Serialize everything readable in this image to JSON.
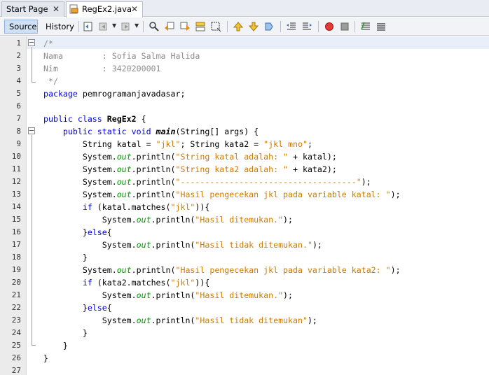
{
  "tabs": [
    {
      "label": "Start Page",
      "close": "✕"
    },
    {
      "label": "RegEx2.java",
      "close": "✕"
    }
  ],
  "toolbar": {
    "source_label": "Source",
    "history_label": "History"
  },
  "editor": {
    "line_numbers": [
      "1",
      "2",
      "3",
      "4",
      "5",
      "6",
      "7",
      "8",
      "9",
      "10",
      "11",
      "12",
      "13",
      "14",
      "15",
      "16",
      "17",
      "18",
      "19",
      "20",
      "21",
      "22",
      "23",
      "24",
      "25",
      "26",
      "27"
    ],
    "lines": [
      [
        {
          "t": "/*",
          "c": "cm"
        }
      ],
      [
        {
          "t": "Nama        : Sofia Salma Halida",
          "c": "cm"
        }
      ],
      [
        {
          "t": "Nim         : 3420200001",
          "c": "cm"
        }
      ],
      [
        {
          "t": " */",
          "c": "cm"
        }
      ],
      [
        {
          "t": "package",
          "c": "kw"
        },
        {
          "t": " pemrogramanjavadasar;",
          "c": ""
        }
      ],
      [],
      [
        {
          "t": "public class",
          "c": "kw"
        },
        {
          "t": " ",
          "c": ""
        },
        {
          "t": "RegEx2",
          "c": "cls"
        },
        {
          "t": " {",
          "c": ""
        }
      ],
      [
        {
          "t": "    ",
          "c": ""
        },
        {
          "t": "public static void",
          "c": "kw"
        },
        {
          "t": " ",
          "c": ""
        },
        {
          "t": "main",
          "c": "mth"
        },
        {
          "t": "(String[] args) {",
          "c": ""
        }
      ],
      [
        {
          "t": "        String katal = ",
          "c": ""
        },
        {
          "t": "\"jkl\"",
          "c": "str"
        },
        {
          "t": "; String kata2 = ",
          "c": ""
        },
        {
          "t": "\"jkl mno\"",
          "c": "str"
        },
        {
          "t": ";",
          "c": ""
        }
      ],
      [
        {
          "t": "        System.",
          "c": ""
        },
        {
          "t": "out",
          "c": "fld"
        },
        {
          "t": ".println(",
          "c": ""
        },
        {
          "t": "\"String katal adalah: \"",
          "c": "str"
        },
        {
          "t": " + katal);",
          "c": ""
        }
      ],
      [
        {
          "t": "        System.",
          "c": ""
        },
        {
          "t": "out",
          "c": "fld"
        },
        {
          "t": ".println(",
          "c": ""
        },
        {
          "t": "\"String kata2 adalah: \"",
          "c": "str"
        },
        {
          "t": " + kata2);",
          "c": ""
        }
      ],
      [
        {
          "t": "        System.",
          "c": ""
        },
        {
          "t": "out",
          "c": "fld"
        },
        {
          "t": ".println(",
          "c": ""
        },
        {
          "t": "\"------------------------------------\"",
          "c": "str"
        },
        {
          "t": ");",
          "c": ""
        }
      ],
      [
        {
          "t": "        System.",
          "c": ""
        },
        {
          "t": "out",
          "c": "fld"
        },
        {
          "t": ".println(",
          "c": ""
        },
        {
          "t": "\"Hasil pengecekan jkl pada variable katal: \"",
          "c": "str"
        },
        {
          "t": ");",
          "c": ""
        }
      ],
      [
        {
          "t": "        ",
          "c": ""
        },
        {
          "t": "if",
          "c": "kw"
        },
        {
          "t": " (katal.matches(",
          "c": ""
        },
        {
          "t": "\"jkl\"",
          "c": "str"
        },
        {
          "t": ")){",
          "c": ""
        }
      ],
      [
        {
          "t": "            System.",
          "c": ""
        },
        {
          "t": "out",
          "c": "fld"
        },
        {
          "t": ".println(",
          "c": ""
        },
        {
          "t": "\"Hasil ditemukan.\"",
          "c": "str"
        },
        {
          "t": ");",
          "c": ""
        }
      ],
      [
        {
          "t": "        }",
          "c": ""
        },
        {
          "t": "else",
          "c": "kw"
        },
        {
          "t": "{",
          "c": ""
        }
      ],
      [
        {
          "t": "            System.",
          "c": ""
        },
        {
          "t": "out",
          "c": "fld"
        },
        {
          "t": ".println(",
          "c": ""
        },
        {
          "t": "\"Hasil tidak ditemukan.\"",
          "c": "str"
        },
        {
          "t": ");",
          "c": ""
        }
      ],
      [
        {
          "t": "        }",
          "c": ""
        }
      ],
      [
        {
          "t": "        System.",
          "c": ""
        },
        {
          "t": "out",
          "c": "fld"
        },
        {
          "t": ".println(",
          "c": ""
        },
        {
          "t": "\"Hasil pengecekan jkl pada variable kata2: \"",
          "c": "str"
        },
        {
          "t": ");",
          "c": ""
        }
      ],
      [
        {
          "t": "        ",
          "c": ""
        },
        {
          "t": "if",
          "c": "kw"
        },
        {
          "t": " (kata2.matches(",
          "c": ""
        },
        {
          "t": "\"jkl\"",
          "c": "str"
        },
        {
          "t": ")){",
          "c": ""
        }
      ],
      [
        {
          "t": "            System.",
          "c": ""
        },
        {
          "t": "out",
          "c": "fld"
        },
        {
          "t": ".println(",
          "c": ""
        },
        {
          "t": "\"Hasil ditemukan.\"",
          "c": "str"
        },
        {
          "t": ");",
          "c": ""
        }
      ],
      [
        {
          "t": "        }",
          "c": ""
        },
        {
          "t": "else",
          "c": "kw"
        },
        {
          "t": "{",
          "c": ""
        }
      ],
      [
        {
          "t": "            System.",
          "c": ""
        },
        {
          "t": "out",
          "c": "fld"
        },
        {
          "t": ".println(",
          "c": ""
        },
        {
          "t": "\"Hasil tidak ditemukan\"",
          "c": "str"
        },
        {
          "t": ");",
          "c": ""
        }
      ],
      [
        {
          "t": "        }",
          "c": ""
        }
      ],
      [
        {
          "t": "    }",
          "c": ""
        }
      ],
      [
        {
          "t": "}",
          "c": ""
        }
      ],
      []
    ]
  },
  "colors": {
    "keyword": "#0000e6",
    "string": "#ce7b00",
    "comment": "#8c8c8c",
    "field": "#009900"
  }
}
